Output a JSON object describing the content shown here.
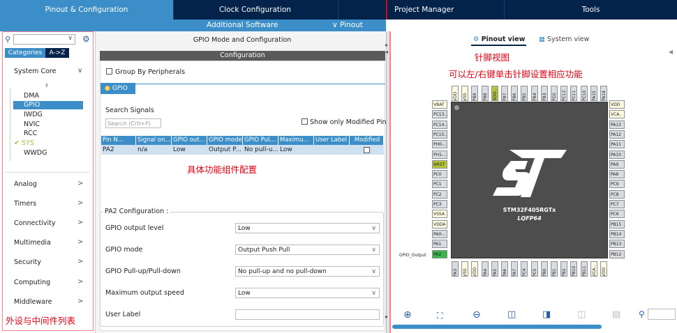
{
  "tabs": [
    {
      "label": "Pinout & Configuration"
    },
    {
      "label": "Clock Configuration"
    },
    {
      "label": "Project Manager"
    },
    {
      "label": "Tools"
    }
  ],
  "subnav": {
    "additional_software": "Additional Software",
    "pinout": "∨ Pinout"
  },
  "left": {
    "categories_tab": "Categories",
    "az_tab": "A->Z",
    "system_core": "System Core",
    "items": [
      "DMA",
      "GPIO",
      "IWDG",
      "NVIC",
      "RCC",
      "SYS",
      "WWDG"
    ],
    "selected": "GPIO",
    "checked_item_prefix": "✔ ",
    "groups": [
      "Analog",
      "Timers",
      "Connectivity",
      "Multimedia",
      "Security",
      "Computing",
      "Middleware"
    ]
  },
  "middle": {
    "title": "GPIO Mode and Configuration",
    "config_header": "Configuration",
    "group_by": "Group By Peripherals",
    "gpio_tab": "GPIO",
    "search_signals": "Search Signals",
    "search_placeholder": "Search (Crtl+F)",
    "show_modified": "Show only Modified Pins",
    "columns": [
      "Pin N...",
      "Signal on...",
      "GPIO out...",
      "GPIO mode",
      "GPIO Pul...",
      "Maximu...",
      "User Label",
      "Modified"
    ],
    "row": [
      "PA2",
      "n/a",
      "Low",
      "Output P...",
      "No pull-u...",
      "Low",
      "",
      ""
    ],
    "pa2_title": "PA2 Configuration :",
    "fields": [
      {
        "label": "GPIO output level",
        "value": "Low"
      },
      {
        "label": "GPIO mode",
        "value": "Output Push Pull"
      },
      {
        "label": "GPIO Pull-up/Pull-down",
        "value": "No pull-up and no pull-down"
      },
      {
        "label": "Maximum output speed",
        "value": "Low"
      },
      {
        "label": "User Label",
        "value": ""
      }
    ]
  },
  "right": {
    "pinout_view": "Pinout view",
    "system_view": "System view",
    "chip_name": "STM32F405RGTx",
    "package": "LQFP64",
    "gpio_output_label": "GPIO_Output",
    "left_pins": [
      "VBAT",
      "PC13..",
      "PC14..",
      "PC15..",
      "PH0-..",
      "PH1-..",
      "NRST",
      "PC0",
      "PC1",
      "PC2",
      "PC3",
      "VSSA",
      "VDDA",
      "PA0-..",
      "PA1",
      "PA2"
    ],
    "right_pins": [
      "VDD",
      "VCA..",
      "PA13",
      "PA12",
      "PA11",
      "PA10",
      "PA9",
      "PA8",
      "PC9",
      "PC8",
      "PC7",
      "PC6",
      "PB15",
      "PB14",
      "PB13",
      "PB12"
    ],
    "top_pins": [
      "VDD",
      "VSS",
      "PB9",
      "PB8",
      "BOO..",
      "PB7",
      "PB6",
      "PB5",
      "PB4",
      "PB3",
      "PD2",
      "PC12",
      "PC11",
      "PC10",
      "PA15",
      "PA14"
    ],
    "bottom_pins": [
      "PA3",
      "VSS",
      "VDD",
      "PA4",
      "PA5",
      "PA6",
      "PA7",
      "PC4",
      "PC5",
      "PB0",
      "PB1",
      "PB2",
      "PB10",
      "PB11",
      "VCA..",
      "VDD"
    ]
  },
  "annotations": {
    "pin_view": "针脚视图",
    "pin_hint": "可以左/右键单击针脚设置相应功能",
    "component_config": "具体功能组件配置",
    "peripheral_list": "外设与中间件列表"
  },
  "colors": {
    "navy": "#03234b",
    "accent": "#3c8ec9",
    "annot": "#e60012",
    "pin_green": "#3cb44b",
    "pin_olive": "#b4c43c"
  }
}
